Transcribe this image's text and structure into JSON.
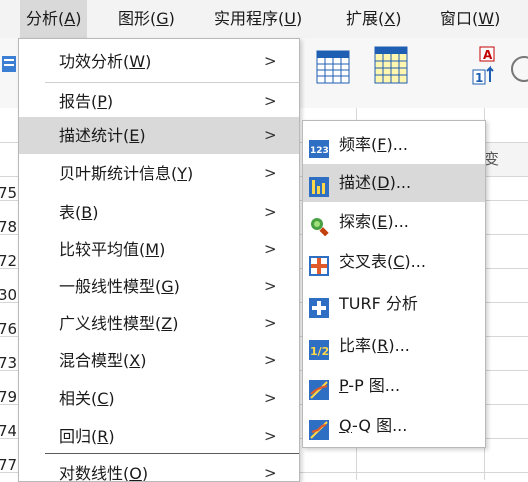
{
  "menubar": {
    "items": [
      {
        "label": "分析(",
        "key": "A",
        "tail": ")",
        "active": true
      },
      {
        "label": "图形(",
        "key": "G",
        "tail": ")"
      },
      {
        "label": "实用程序(",
        "key": "U",
        "tail": ")"
      },
      {
        "label": "扩展(",
        "key": "X",
        "tail": ")"
      },
      {
        "label": "窗口(",
        "key": "W",
        "tail": ")"
      }
    ]
  },
  "grid": {
    "rows": [
      "75",
      "78",
      "72",
      "30",
      "76",
      "73",
      "79",
      "74",
      "77"
    ],
    "partial_header": "变"
  },
  "analyze_menu": {
    "items": [
      {
        "label": "功效分析(",
        "key": "W",
        "tail": ")",
        "arrow": ">"
      },
      {
        "label": "报告(",
        "key": "P",
        "tail": ")",
        "arrow": ">"
      },
      {
        "label": "描述统计(",
        "key": "E",
        "tail": ")",
        "arrow": ">",
        "highlighted": true
      },
      {
        "label": "贝叶斯统计信息(",
        "key": "Y",
        "tail": ")",
        "arrow": ">"
      },
      {
        "label": "表(",
        "key": "B",
        "tail": ")",
        "arrow": ">"
      },
      {
        "label": "比较平均值(",
        "key": "M",
        "tail": ")",
        "arrow": ">"
      },
      {
        "label": "一般线性模型(",
        "key": "G",
        "tail": ")",
        "arrow": ">"
      },
      {
        "label": "广义线性模型(",
        "key": "Z",
        "tail": ")",
        "arrow": ">"
      },
      {
        "label": "混合模型(",
        "key": "X",
        "tail": ")",
        "arrow": ">"
      },
      {
        "label": "相关(",
        "key": "C",
        "tail": ")",
        "arrow": ">"
      },
      {
        "label": "回归(",
        "key": "R",
        "tail": ")",
        "arrow": ">"
      },
      {
        "label": "对数线性(",
        "key": "O",
        "tail": ")",
        "arrow": ">"
      }
    ]
  },
  "descriptives_submenu": {
    "items": [
      {
        "label": "频率(",
        "key": "F",
        "tail": ")...",
        "icon": "frequencies-icon"
      },
      {
        "label": "描述(",
        "key": "D",
        "tail": ")...",
        "icon": "descriptives-icon",
        "highlighted": true
      },
      {
        "label": "探索(",
        "key": "E",
        "tail": ")...",
        "icon": "explore-icon"
      },
      {
        "label": "交叉表(",
        "key": "C",
        "tail": ")...",
        "icon": "crosstabs-icon"
      },
      {
        "label": "TURF 分析",
        "key": "",
        "tail": "",
        "icon": "turf-icon"
      },
      {
        "label": "比率(",
        "key": "R",
        "tail": ")...",
        "icon": "ratio-icon"
      },
      {
        "label": "",
        "key": "P",
        "tail": "-P 图...",
        "icon": "pp-plot-icon"
      },
      {
        "label": "",
        "key": "Q",
        "tail": "-Q 图...",
        "icon": "qq-plot-icon"
      }
    ]
  },
  "toolbar": {
    "icons": [
      "variable-icon",
      "table-icon",
      "highlight-table-icon",
      "sort-icon"
    ],
    "value_label_chars": [
      "A",
      "1"
    ]
  }
}
